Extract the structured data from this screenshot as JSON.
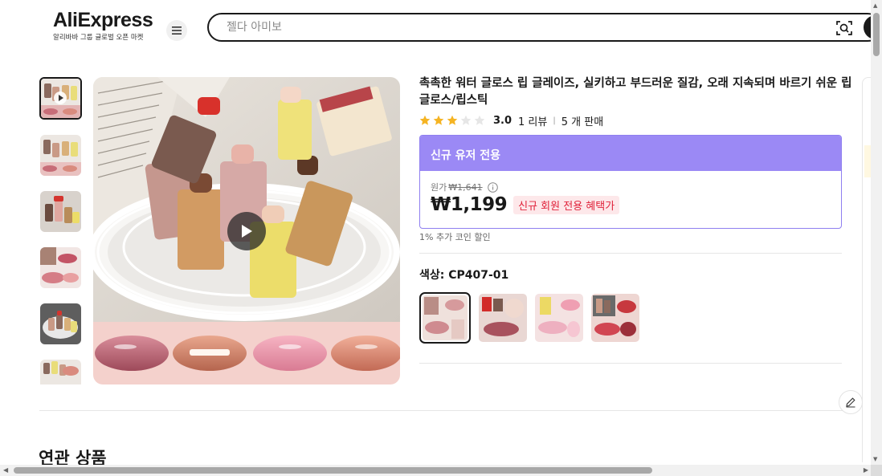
{
  "header": {
    "logo": "AliExpress",
    "logo_sub": "알리바바 그룹 글로벌 오픈 마켓",
    "search_placeholder": "젤다 아미보"
  },
  "product": {
    "title": "촉촉한 워터 글로스 립 글레이즈, 실키하고 부드러운 질감, 오래 지속되며 바르기 쉬운 립 글로스/립스틱",
    "rating": "3.0",
    "stars_filled": 3,
    "stars_total": 5,
    "reviews": "1 리뷰",
    "sold": "5 개 판매",
    "promo_header": "신규 유저 전용",
    "original_label": "원가",
    "original_price": "₩1,641",
    "price": "₩1,199",
    "promo_tag": "신규 회원 전용 혜택가",
    "coin_note": "1% 추가 코인 할인",
    "color_label": "색상: CP407-01"
  },
  "thumbnails": [
    "thumb-1",
    "thumb-2",
    "thumb-3",
    "thumb-4",
    "thumb-5",
    "thumb-6"
  ],
  "swatches": [
    "CP407-01",
    "CP407-02",
    "CP407-03",
    "CP407-04"
  ],
  "related_title": "연관 상품",
  "colors": {
    "accent_purple": "#9b89f5",
    "promo_red": "#e0233b",
    "star_gold": "#f5b423"
  }
}
